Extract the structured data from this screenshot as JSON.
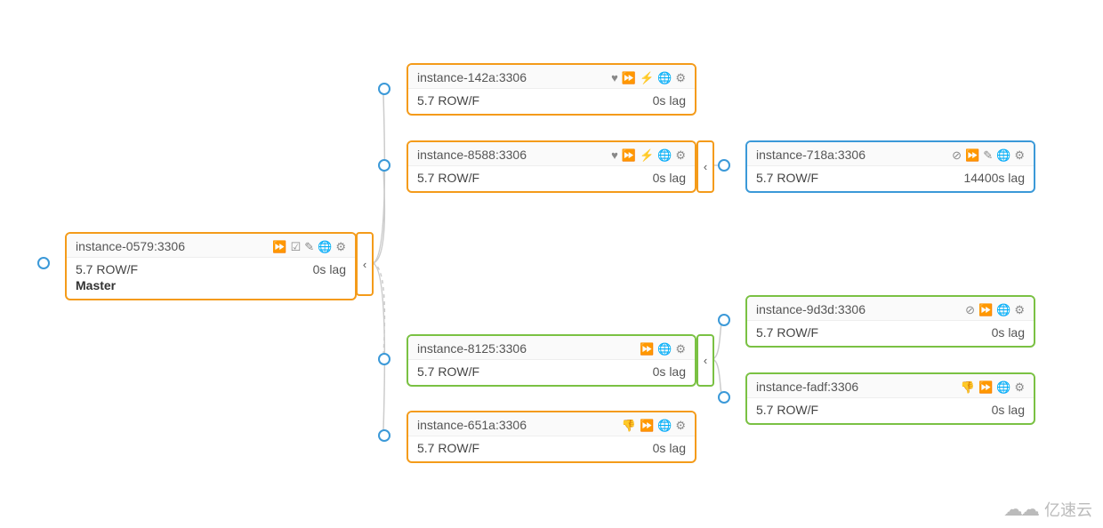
{
  "nodes": {
    "master": {
      "name": "instance-0579:3306",
      "version": "5.7 ROW/F",
      "role": "Master",
      "lag": "0s lag",
      "color": "orange",
      "icons": [
        "forward",
        "check-edit",
        "pencil",
        "globe",
        "gear"
      ],
      "hasCollapse": true
    },
    "n142a": {
      "name": "instance-142a:3306",
      "version": "5.7 ROW/F",
      "lag": "0s lag",
      "color": "orange",
      "icons": [
        "heart",
        "forward",
        "downtime",
        "globe",
        "gear"
      ]
    },
    "n8588": {
      "name": "instance-8588:3306",
      "version": "5.7 ROW/F",
      "lag": "0s lag",
      "color": "orange",
      "icons": [
        "heart",
        "forward",
        "downtime",
        "globe",
        "gear"
      ],
      "hasCollapse": true
    },
    "n718a": {
      "name": "instance-718a:3306",
      "version": "5.7 ROW/F",
      "lag": "14400s lag",
      "color": "blue",
      "icons": [
        "stop",
        "forward",
        "pencil",
        "globe",
        "gear"
      ]
    },
    "n8125": {
      "name": "instance-8125:3306",
      "version": "5.7 ROW/F",
      "lag": "0s lag",
      "color": "green",
      "icons": [
        "forward",
        "globe",
        "gear"
      ],
      "hasCollapse": true
    },
    "n651a": {
      "name": "instance-651a:3306",
      "version": "5.7 ROW/F",
      "lag": "0s lag",
      "color": "orange",
      "icons": [
        "thumbs-down",
        "forward",
        "globe",
        "gear"
      ]
    },
    "n9d3d": {
      "name": "instance-9d3d:3306",
      "version": "5.7 ROW/F",
      "lag": "0s lag",
      "color": "green",
      "icons": [
        "stop",
        "forward",
        "globe",
        "gear"
      ]
    },
    "nfadf": {
      "name": "instance-fadf:3306",
      "version": "5.7 ROW/F",
      "lag": "0s lag",
      "color": "green",
      "icons": [
        "thumbs-down",
        "forward",
        "globe",
        "gear"
      ]
    }
  },
  "iconGlyphs": {
    "heart": "♥",
    "forward": "⏩",
    "downtime": "⚡",
    "globe": "🌐",
    "gear": "⚙",
    "check-edit": "☑",
    "pencil": "✎",
    "stop": "⊘",
    "thumbs-down": "👎"
  },
  "watermark": "亿速云"
}
